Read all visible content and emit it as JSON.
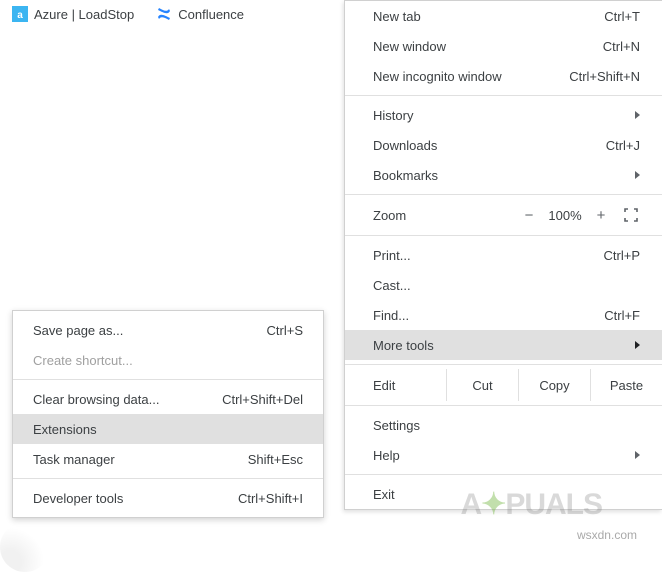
{
  "bookmarks": {
    "items": [
      {
        "label": "Azure | LoadStop",
        "iconColor": "#0078d4"
      },
      {
        "label": "Confluence",
        "iconColor": "#2684ff"
      }
    ]
  },
  "mainMenu": {
    "newTab": {
      "label": "New tab",
      "shortcut": "Ctrl+T"
    },
    "newWindow": {
      "label": "New window",
      "shortcut": "Ctrl+N"
    },
    "newIncognito": {
      "label": "New incognito window",
      "shortcut": "Ctrl+Shift+N"
    },
    "history": {
      "label": "History"
    },
    "downloads": {
      "label": "Downloads",
      "shortcut": "Ctrl+J"
    },
    "bookmarks": {
      "label": "Bookmarks"
    },
    "zoom": {
      "label": "Zoom",
      "level": "100%"
    },
    "print": {
      "label": "Print...",
      "shortcut": "Ctrl+P"
    },
    "cast": {
      "label": "Cast..."
    },
    "find": {
      "label": "Find...",
      "shortcut": "Ctrl+F"
    },
    "moreTools": {
      "label": "More tools"
    },
    "edit": {
      "label": "Edit",
      "cut": "Cut",
      "copy": "Copy",
      "paste": "Paste"
    },
    "settings": {
      "label": "Settings"
    },
    "help": {
      "label": "Help"
    },
    "exit": {
      "label": "Exit"
    }
  },
  "moreToolsSubmenu": {
    "savePageAs": {
      "label": "Save page as...",
      "shortcut": "Ctrl+S"
    },
    "createShortcut": {
      "label": "Create shortcut..."
    },
    "clearBrowsingData": {
      "label": "Clear browsing data...",
      "shortcut": "Ctrl+Shift+Del"
    },
    "extensions": {
      "label": "Extensions"
    },
    "taskManager": {
      "label": "Task manager",
      "shortcut": "Shift+Esc"
    },
    "developerTools": {
      "label": "Developer tools",
      "shortcut": "Ctrl+Shift+I"
    }
  },
  "watermark": {
    "brand_left": "A",
    "brand_right": "PUALS",
    "domain": "wsxdn.com"
  }
}
